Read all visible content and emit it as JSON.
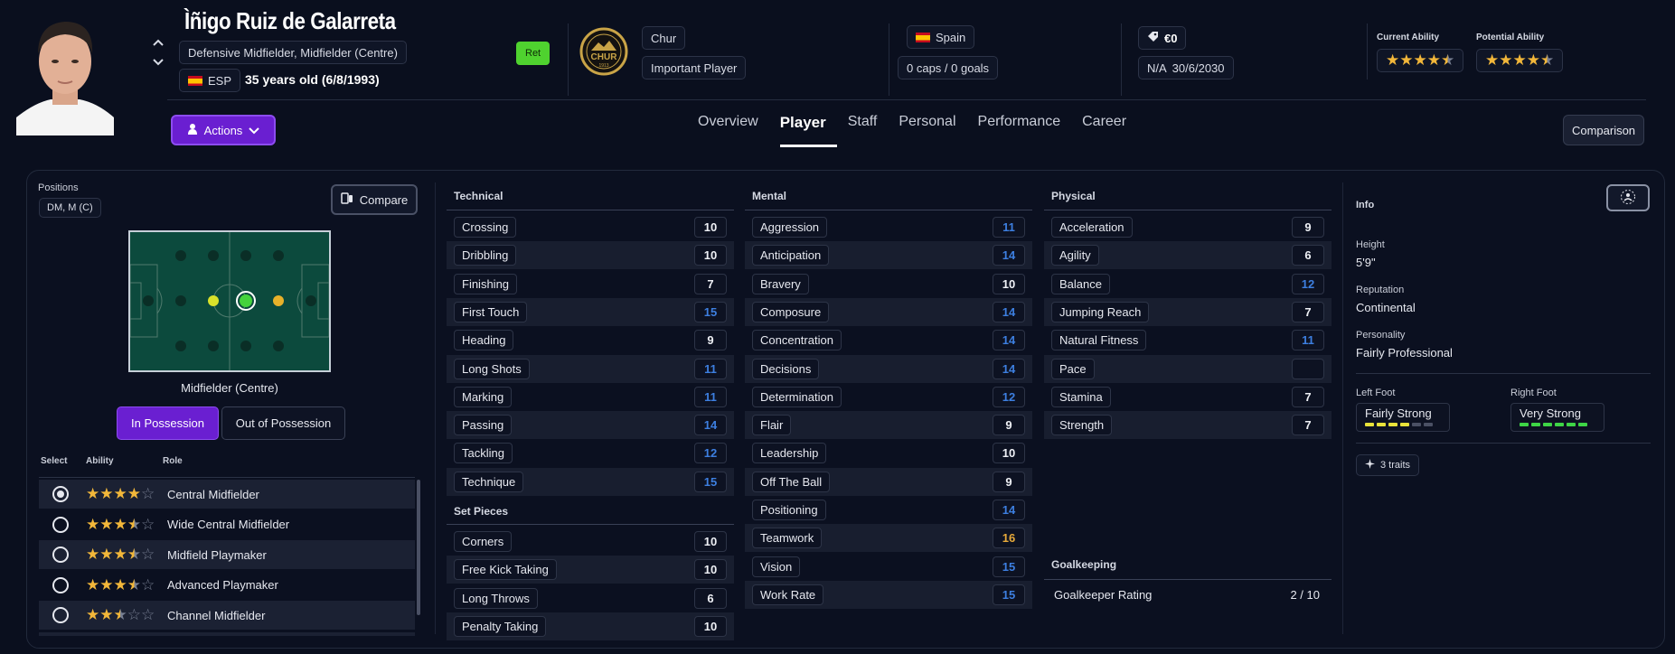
{
  "player": {
    "name": "Ìñigo Ruiz de Galarreta",
    "positions_text": "Defensive Midfielder, Midfielder (Centre)",
    "nation_code": "ESP",
    "age_text": "35 years old (6/8/1993)",
    "status_badge": "Ret"
  },
  "club": {
    "badge_text": "CHUR",
    "badge_year": "1913",
    "name": "Chur",
    "role": "Important Player"
  },
  "international": {
    "country": "Spain",
    "caps_goals": "0 caps / 0 goals"
  },
  "contract": {
    "value": "€0",
    "wage": "N/A",
    "expiry": "30/6/2030"
  },
  "ability": {
    "current_label": "Current Ability",
    "current_stars": 4.5,
    "potential_label": "Potential Ability",
    "potential_stars": 4.5
  },
  "nav": {
    "actions_label": "Actions",
    "comparison_label": "Comparison",
    "tabs": [
      "Overview",
      "Player",
      "Staff",
      "Personal",
      "Performance",
      "Career"
    ],
    "active_tab": "Player"
  },
  "positions_panel": {
    "label": "Positions",
    "badge": "DM, M (C)",
    "compare_label": "Compare",
    "selected_position": "Midfielder (Centre)",
    "in_possession_label": "In Possession",
    "out_possession_label": "Out of Possession",
    "table_headers": {
      "select": "Select",
      "ability": "Ability",
      "role": "Role"
    },
    "roles": [
      {
        "name": "Central Midfielder",
        "stars": 4,
        "selected": true
      },
      {
        "name": "Wide Central Midfielder",
        "stars": 3.5,
        "selected": false
      },
      {
        "name": "Midfield Playmaker",
        "stars": 3.5,
        "selected": false
      },
      {
        "name": "Advanced Playmaker",
        "stars": 3.5,
        "selected": false
      },
      {
        "name": "Channel Midfielder",
        "stars": 2.5,
        "selected": false
      }
    ]
  },
  "technical": {
    "title": "Technical",
    "attributes": [
      {
        "name": "Crossing",
        "value": "10",
        "tone": "w"
      },
      {
        "name": "Dribbling",
        "value": "10",
        "tone": "w"
      },
      {
        "name": "Finishing",
        "value": "7",
        "tone": "w"
      },
      {
        "name": "First Touch",
        "value": "15",
        "tone": "b"
      },
      {
        "name": "Heading",
        "value": "9",
        "tone": "w"
      },
      {
        "name": "Long Shots",
        "value": "11",
        "tone": "b"
      },
      {
        "name": "Marking",
        "value": "11",
        "tone": "b"
      },
      {
        "name": "Passing",
        "value": "14",
        "tone": "b"
      },
      {
        "name": "Tackling",
        "value": "12",
        "tone": "b"
      },
      {
        "name": "Technique",
        "value": "15",
        "tone": "b"
      }
    ]
  },
  "set_pieces": {
    "title": "Set Pieces",
    "attributes": [
      {
        "name": "Corners",
        "value": "10",
        "tone": "w"
      },
      {
        "name": "Free Kick Taking",
        "value": "10",
        "tone": "w"
      },
      {
        "name": "Long Throws",
        "value": "6",
        "tone": "w"
      },
      {
        "name": "Penalty Taking",
        "value": "10",
        "tone": "w"
      }
    ]
  },
  "mental": {
    "title": "Mental",
    "attributes": [
      {
        "name": "Aggression",
        "value": "11",
        "tone": "b"
      },
      {
        "name": "Anticipation",
        "value": "14",
        "tone": "b"
      },
      {
        "name": "Bravery",
        "value": "10",
        "tone": "w"
      },
      {
        "name": "Composure",
        "value": "14",
        "tone": "b"
      },
      {
        "name": "Concentration",
        "value": "14",
        "tone": "b"
      },
      {
        "name": "Decisions",
        "value": "14",
        "tone": "b"
      },
      {
        "name": "Determination",
        "value": "12",
        "tone": "b"
      },
      {
        "name": "Flair",
        "value": "9",
        "tone": "w"
      },
      {
        "name": "Leadership",
        "value": "10",
        "tone": "w"
      },
      {
        "name": "Off The Ball",
        "value": "9",
        "tone": "w"
      },
      {
        "name": "Positioning",
        "value": "14",
        "tone": "b"
      },
      {
        "name": "Teamwork",
        "value": "16",
        "tone": "y"
      },
      {
        "name": "Vision",
        "value": "15",
        "tone": "b"
      },
      {
        "name": "Work Rate",
        "value": "15",
        "tone": "b"
      }
    ]
  },
  "physical": {
    "title": "Physical",
    "attributes": [
      {
        "name": "Acceleration",
        "value": "9",
        "tone": "w"
      },
      {
        "name": "Agility",
        "value": "6",
        "tone": "w"
      },
      {
        "name": "Balance",
        "value": "12",
        "tone": "b"
      },
      {
        "name": "Jumping Reach",
        "value": "7",
        "tone": "w"
      },
      {
        "name": "Natural Fitness",
        "value": "11",
        "tone": "b"
      },
      {
        "name": "Pace",
        "value": "",
        "tone": "w"
      },
      {
        "name": "Stamina",
        "value": "7",
        "tone": "w"
      },
      {
        "name": "Strength",
        "value": "7",
        "tone": "w"
      }
    ]
  },
  "goalkeeping": {
    "title": "Goalkeeping",
    "rating_label": "Goalkeeper Rating",
    "rating_value": "2 / 10"
  },
  "info": {
    "title": "Info",
    "height_label": "Height",
    "height_value": "5'9\"",
    "reputation_label": "Reputation",
    "reputation_value": "Continental",
    "personality_label": "Personality",
    "personality_value": "Fairly Professional",
    "left_foot_label": "Left Foot",
    "left_foot_value": "Fairly Strong",
    "left_foot_level": 4,
    "right_foot_label": "Right Foot",
    "right_foot_value": "Very Strong",
    "right_foot_level": 6,
    "traits_label": "3 traits"
  },
  "colors": {
    "accent": "#6a1fd1",
    "attr_high": "#e6a93a",
    "attr_good": "#3d7fe0",
    "left_foot_bar": "#e8e23a",
    "right_foot_bar": "#3ed646",
    "pitch": "#0c4a3d"
  }
}
